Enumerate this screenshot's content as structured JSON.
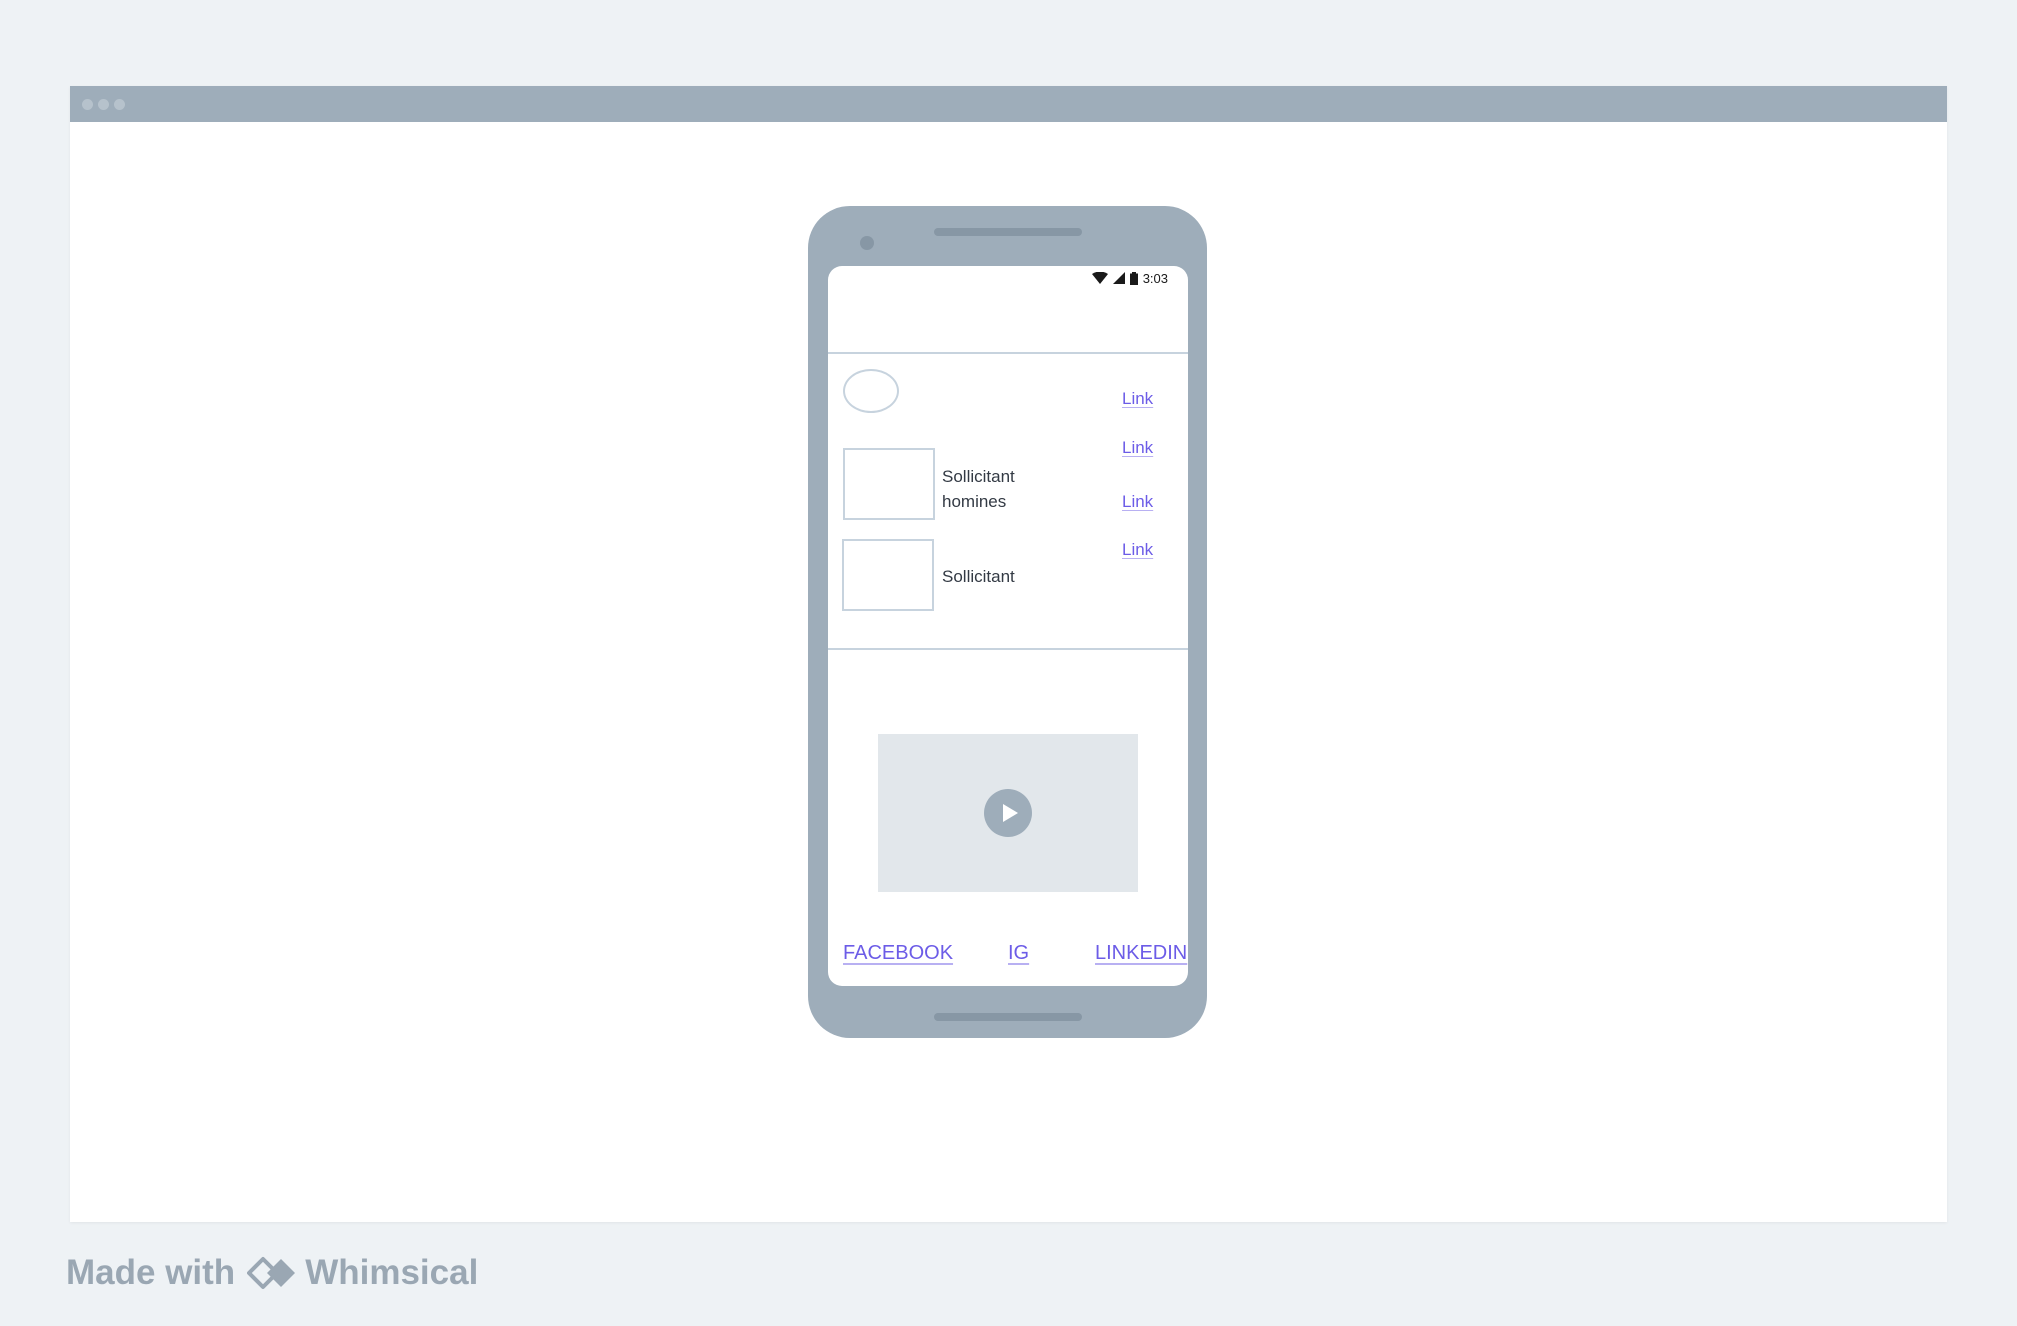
{
  "status_bar": {
    "time": "3:03",
    "icons": [
      "wifi-icon",
      "signal-icon",
      "battery-icon"
    ]
  },
  "header_links": [
    "Link",
    "Link",
    "Link",
    "Link"
  ],
  "list_items": [
    {
      "text": "Sollicitant homines"
    },
    {
      "text": "Sollicitant"
    }
  ],
  "video": {
    "icon": "play-icon"
  },
  "social_links": {
    "facebook": "FACEBOOK",
    "ig": "IG",
    "linkedin": "LINKEDIN"
  },
  "footer": {
    "made_with": "Made with",
    "brand": "Whimsical"
  },
  "colors": {
    "link": "#6c5ce7",
    "device": "#9eadba",
    "background": "#eef2f5"
  }
}
